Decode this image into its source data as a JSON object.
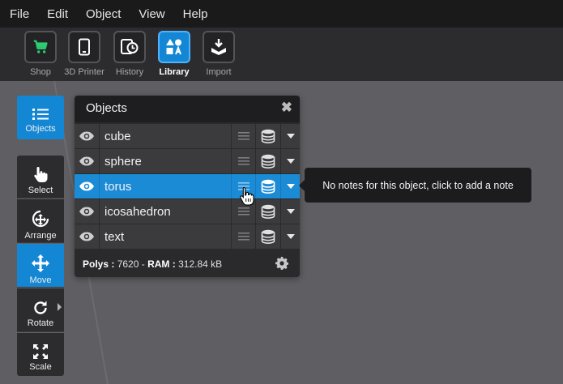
{
  "menu": [
    "File",
    "Edit",
    "Object",
    "View",
    "Help"
  ],
  "toolbar": [
    {
      "label": "Shop",
      "icon": "cart-icon",
      "active": false
    },
    {
      "label": "3D Printer",
      "icon": "phone-icon",
      "active": false
    },
    {
      "label": "History",
      "icon": "history-icon",
      "active": false
    },
    {
      "label": "Library",
      "icon": "shapes-icon",
      "active": true
    },
    {
      "label": "Import",
      "icon": "import-icon",
      "active": false
    }
  ],
  "sidebar": {
    "objects": "Objects",
    "select": "Select",
    "arrange": "Arrange",
    "move": "Move",
    "rotate": "Rotate",
    "scale": "Scale"
  },
  "panel": {
    "title": "Objects",
    "close": "✖",
    "rows": [
      {
        "name": "cube",
        "selected": false
      },
      {
        "name": "sphere",
        "selected": false
      },
      {
        "name": "torus",
        "selected": true
      },
      {
        "name": "icosahedron",
        "selected": false
      },
      {
        "name": "text",
        "selected": false
      }
    ],
    "polys_label": "Polys :",
    "polys_value": "7620",
    "sep": "-",
    "ram_label": "RAM :",
    "ram_value": "312.84 kB"
  },
  "tooltip": "No notes for this object, click to add a note",
  "colors": {
    "accent": "#1487d4",
    "menubar": "#1a1a1b",
    "shop_icon": "#2ecc71"
  }
}
